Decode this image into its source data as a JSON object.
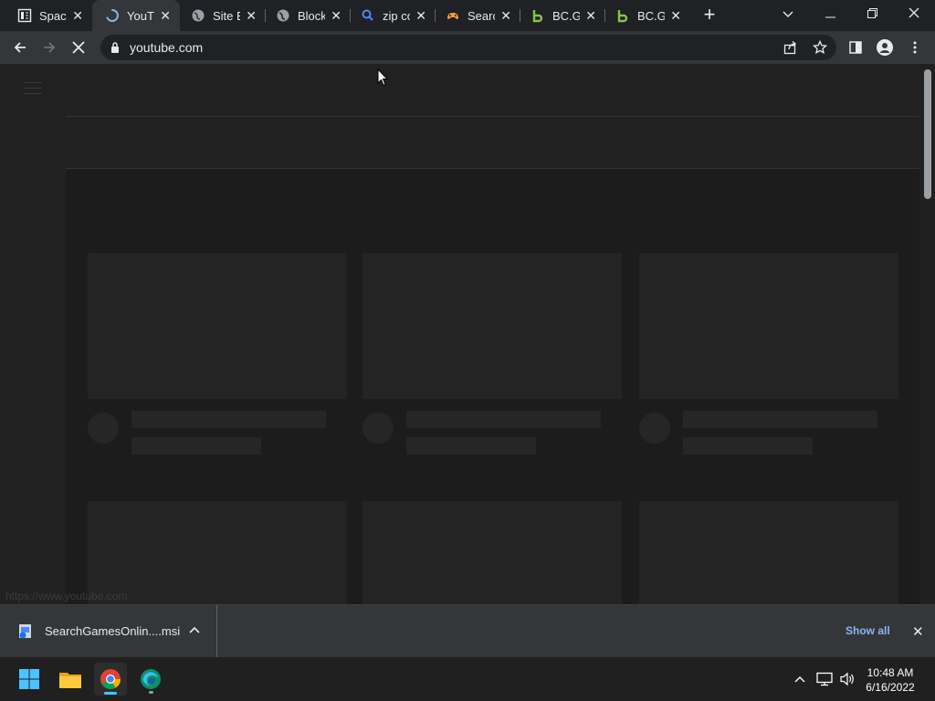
{
  "browser": {
    "tabs": [
      {
        "title": "Space",
        "icon": "page-icon",
        "active": false
      },
      {
        "title": "YouTu",
        "icon": "loading-spinner-icon",
        "active": true
      },
      {
        "title": "Site B",
        "icon": "globe-icon",
        "active": false
      },
      {
        "title": "Block",
        "icon": "globe-icon",
        "active": false
      },
      {
        "title": "zip co",
        "icon": "search-icon",
        "active": false
      },
      {
        "title": "Searc",
        "icon": "gamepad-icon",
        "active": false
      },
      {
        "title": "BC.Ga",
        "icon": "bc-game-icon",
        "active": false
      },
      {
        "title": "BC.Ga",
        "icon": "bc-game-icon",
        "active": false
      }
    ],
    "close_glyph": "✕",
    "new_tab_glyph": "+",
    "address_bar": {
      "url": "youtube.com"
    }
  },
  "page": {
    "status_url": "https://www.youtube.com"
  },
  "download_bar": {
    "file_name": "SearchGamesOnlin....msi",
    "show_all_label": "Show all",
    "close_glyph": "✕"
  },
  "taskbar": {
    "time": "10:48 AM",
    "date": "6/16/2022"
  },
  "colors": {
    "accent_link": "#8ab4f8",
    "taskbar_indicator": "#4cc2ff",
    "bc_game_green": "#8bc34a"
  }
}
